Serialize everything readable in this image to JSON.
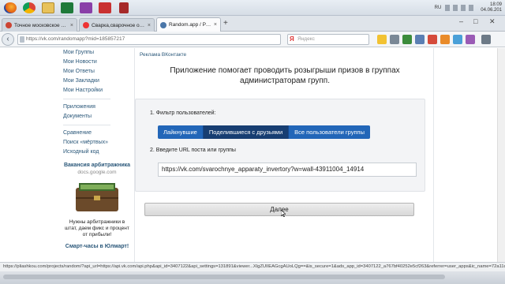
{
  "taskbar": {
    "lang": "RU",
    "time": "18:09",
    "date": "04.06.201",
    "icons": [
      "firefox-icon",
      "chrome-icon",
      "folder-icon",
      "sheet-icon",
      "notebook-icon",
      "app-icon",
      "pdf-icon"
    ]
  },
  "tabs": [
    {
      "label": "Точное московское время",
      "close": "×"
    },
    {
      "label": "Сварка,сварочное оборудо…",
      "close": "×"
    },
    {
      "label": "Random.app / Розыгрыш…",
      "close": "×"
    }
  ],
  "toolbar": {
    "url": "https://vk.com/randomapp?mid=185857217",
    "search_placeholder": "Яндекс",
    "search_logo": "Я",
    "back_label": "‹"
  },
  "sidebar": {
    "items_top": [
      "Мои Группы",
      "Мои Новости",
      "Мои Ответы",
      "Мои Закладки",
      "Мои Настройки"
    ],
    "items_mid": [
      "Приложения",
      "Документы"
    ],
    "items_bottom": [
      "Сравнение",
      "Поиск «мёртвых»",
      "Исходный код"
    ],
    "ad1": {
      "title": "Вакансия арбитражника",
      "source": "docs.google.com",
      "text": "Нужны арбитражники в штат, даем фикс и процент от прибыли!"
    },
    "ad2": {
      "title": "Смарт-часы в Юлмарт!"
    }
  },
  "content": {
    "crumb": "Реклама ВКонтакте",
    "headline": "Приложение помогает проводить розыгрыши призов в группах администраторам групп.",
    "step1_label": "1. Фильтр пользователей:",
    "filters": [
      "Лайкнувшие",
      "Поделившиеся с друзьями",
      "Все пользователи группы"
    ],
    "active_filter_index": 1,
    "step2_label": "2. Введите URL поста или группы",
    "url_value": "https://vk.com/svarochnye_apparaty_invertory?w=wall-43911004_14914",
    "next_label": "Далее"
  },
  "status": {
    "text": "https://pliashkou.com/projects/random/?api_url=https://api.vk.com/api.php&api_id=3407122&api_settings=131891&viewer...XlgZUIIEAGcgAUoLQg==&is_secure=1&ads_app_id=3407122_a767bf40252e5cf263&referrer=user_apps&ic_name=72a11d48&hash="
  },
  "colors": {
    "vk_link": "#2b587a",
    "button_blue": "#2266b8",
    "button_active": "#173e72"
  }
}
